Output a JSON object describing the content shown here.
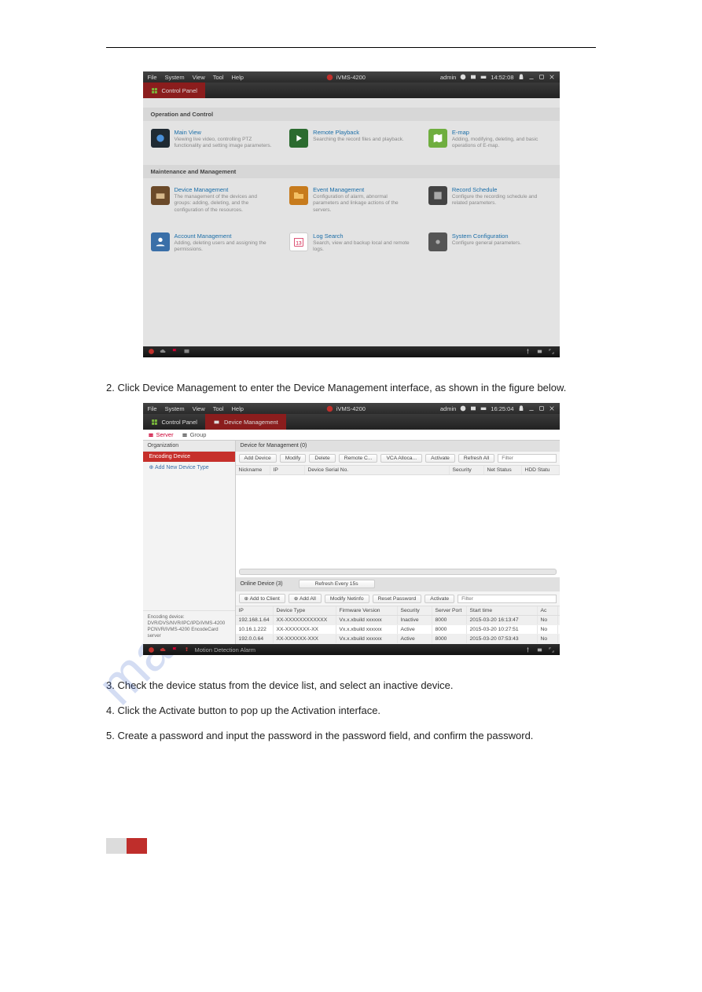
{
  "watermark": "manualslive.com",
  "menubar": {
    "items": [
      "File",
      "System",
      "View",
      "Tool",
      "Help"
    ],
    "title": "iVMS-4200",
    "user": "admin",
    "time1": "14:52:08",
    "time2": "16:25:04"
  },
  "tabs": {
    "control_panel": "Control Panel",
    "device_mgmt": "Device Management"
  },
  "cp": {
    "sec1": "Operation and Control",
    "sec2": "Maintenance and Management",
    "tiles": [
      {
        "title": "Main View",
        "desc": "Viewing live video, controlling PTZ functionality and setting image parameters."
      },
      {
        "title": "Remote Playback",
        "desc": "Searching the record files and playback."
      },
      {
        "title": "E-map",
        "desc": "Adding, modifying, deleting, and basic operations of E-map."
      }
    ],
    "tiles2": [
      {
        "title": "Device Management",
        "desc": "The management of the devices and groups: adding, deleting, and the configuration of the resources."
      },
      {
        "title": "Event Management",
        "desc": "Configuration of alarm, abnormal parameters and linkage actions of the servers."
      },
      {
        "title": "Record Schedule",
        "desc": "Configure the recording schedule and related parameters."
      },
      {
        "title": "Account Management",
        "desc": "Adding, deleting users and assigning the permissions."
      },
      {
        "title": "Log Search",
        "desc": "Search, view and backup local and remote logs."
      },
      {
        "title": "System Configuration",
        "desc": "Configure general parameters."
      }
    ]
  },
  "body_text1": "2. Click Device Management to enter the Device Management interface, as shown in the figure below.",
  "dm": {
    "sub_server": "Server",
    "sub_group": "Group",
    "org_hdr": "Organization",
    "enc_dev": "Encoding Device",
    "add_type": "Add New Device Type",
    "side_note": "Encoding device:\nDVR/DVS/NVR/IPC/IPD/iVMS-4200 PCNVR/iVMS-4200 EncodeCard server",
    "list_hdr": "Device for Management (0)",
    "btns": {
      "add": "Add Device",
      "modify": "Modify",
      "delete": "Delete",
      "remote": "Remote C...",
      "vca": "VCA Alloca...",
      "activate": "Activate",
      "refresh": "Refresh All",
      "filter": "Filter"
    },
    "cols": {
      "nick": "Nickname",
      "ip": "IP",
      "dsn": "Device Serial No.",
      "sec": "Security",
      "net": "Net Status",
      "hdd": "HDD Statu"
    },
    "online_hdr": "Online Device (3)",
    "refresh15": "Refresh Every 15s",
    "btns2": {
      "addc": "Add to Client",
      "addall": "Add All",
      "modnet": "Modify Netinfo",
      "reset": "Reset Password",
      "activate": "Activate",
      "filter": "Filter"
    },
    "cols2": {
      "ip": "IP",
      "dt": "Device Type",
      "fw": "Firmware Version",
      "sec": "Security",
      "sp": "Server Port",
      "st": "Start time",
      "nn": "Ac"
    },
    "rows": [
      {
        "ip": "192.168.1.64",
        "dt": "XX-XXXXXXXXXXXX",
        "fw": "Vx.x.xbuild xxxxxx",
        "sec": "Inactive",
        "sp": "8000",
        "st": "2015-03-20 16:13:47",
        "nn": "No"
      },
      {
        "ip": "10.16.1.222",
        "dt": "XX-XXXXXXX-XX",
        "fw": "Vx.x.xbuild xxxxxx",
        "sec": "Active",
        "sp": "8000",
        "st": "2015-03-20 10:27:51",
        "nn": "No"
      },
      {
        "ip": "192.0.0.64",
        "dt": "XX-XXXXXX-XXX",
        "fw": "Vx.x.xbuild xxxxxx",
        "sec": "Active",
        "sp": "8000",
        "st": "2015-03-20 07:53:43",
        "nn": "No"
      }
    ],
    "footer_text": "Motion Detection Alarm"
  },
  "body_text2": "3. Check the device status from the device list, and select an inactive device.",
  "body_text3": "4. Click the Activate button to pop up the Activation interface.",
  "body_text4": "5. Create a password and input the password in the password field, and confirm the password."
}
